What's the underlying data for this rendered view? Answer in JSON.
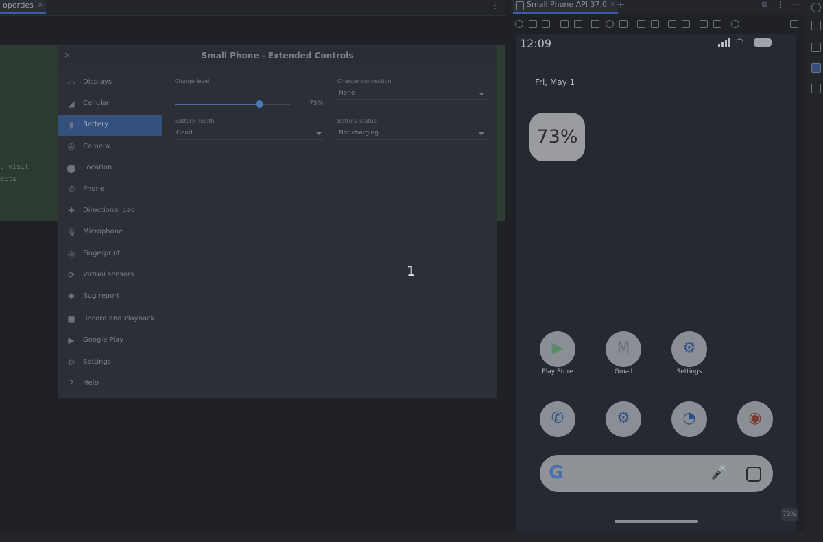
{
  "ide": {
    "tab_label": "operties",
    "tab_close": "×",
    "more": "⋮",
    "code_line1": ", visit",
    "code_line2": "ects"
  },
  "dialog": {
    "close": "×",
    "title": "Small Phone - Extended Controls",
    "sidebar": [
      {
        "label": "Displays",
        "icon": "display-icon",
        "glyph": "▭"
      },
      {
        "label": "Cellular",
        "icon": "cellular-icon",
        "glyph": "◢"
      },
      {
        "label": "Battery",
        "icon": "battery-icon",
        "glyph": "▮",
        "selected": true
      },
      {
        "label": "Camera",
        "icon": "camera-icon",
        "glyph": "✇"
      },
      {
        "label": "Location",
        "icon": "location-icon",
        "glyph": "⬤"
      },
      {
        "label": "Phone",
        "icon": "phone-icon",
        "glyph": "✆"
      },
      {
        "label": "Directional pad",
        "icon": "dpad-icon",
        "glyph": "✚"
      },
      {
        "label": "Microphone",
        "icon": "microphone-icon",
        "glyph": "🎙"
      },
      {
        "label": "Fingerprint",
        "icon": "fingerprint-icon",
        "glyph": "◎"
      },
      {
        "label": "Virtual sensors",
        "icon": "sensors-icon",
        "glyph": "⟳"
      },
      {
        "label": "Bug report",
        "icon": "bug-icon",
        "glyph": "✱"
      },
      {
        "label": "Record and Playback",
        "icon": "record-icon",
        "glyph": "■"
      },
      {
        "label": "Google Play",
        "icon": "play-icon",
        "glyph": "▶"
      },
      {
        "label": "Settings",
        "icon": "settings-icon",
        "glyph": "⚙"
      },
      {
        "label": "Help",
        "icon": "help-icon",
        "glyph": "?"
      }
    ],
    "battery": {
      "charge_level_label": "Charge level",
      "charge_level_value": "73%",
      "charge_level": 73,
      "charger_connection_label": "Charger connection",
      "charger_connection_value": "None",
      "battery_health_label": "Battery health",
      "battery_health_value": "Good",
      "battery_status_label": "Battery status",
      "battery_status_value": "Not charging"
    }
  },
  "overlay": {
    "step_number": "1"
  },
  "emulator": {
    "tab_label": "Small Phone API 37.0",
    "tab_close": "×",
    "add": "+",
    "zoom_badge": "73%",
    "phone": {
      "time": "12:09",
      "date": "Fri, May 1",
      "battery_widget": "73%",
      "apps_row1": [
        {
          "label": "Play Store",
          "icon": "play-store-icon",
          "glyph": "▶",
          "color": "#5a8a6a"
        },
        {
          "label": "Gmail",
          "icon": "gmail-icon",
          "glyph": "M",
          "color": "#6b6e74"
        },
        {
          "label": "Settings",
          "icon": "settings-app-icon",
          "glyph": "⚙",
          "color": "#2c4f86"
        }
      ],
      "apps_row2": [
        {
          "label": "",
          "icon": "phone-app-icon",
          "glyph": "✆",
          "color": "#2c4f86"
        },
        {
          "label": "",
          "icon": "settings-app-icon-2",
          "glyph": "⚙",
          "color": "#2c4f86"
        },
        {
          "label": "",
          "icon": "clock-app-icon",
          "glyph": "◔",
          "color": "#2c4f86"
        },
        {
          "label": "",
          "icon": "chrome-icon",
          "glyph": "◉",
          "color": "#7a3a2e"
        }
      ],
      "search_g": "G",
      "search_mic": "🎤"
    }
  },
  "colors": {
    "accent": "#3a5fa3",
    "selected_item": "#34507e",
    "background": "#1f2127"
  }
}
